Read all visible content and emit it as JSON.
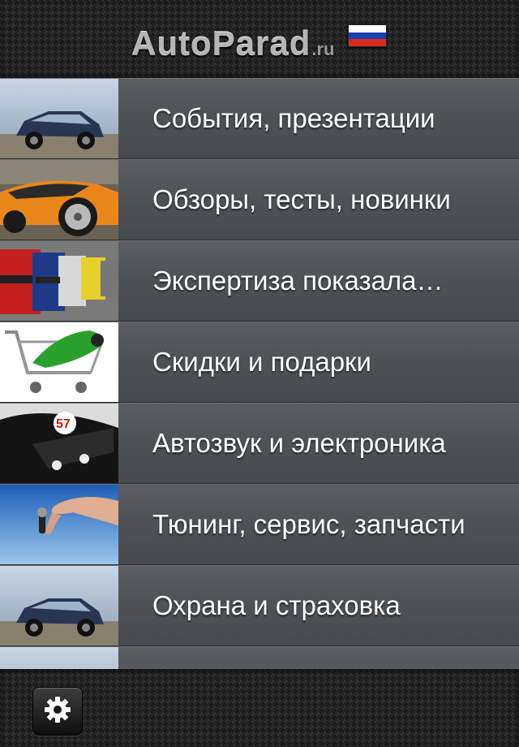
{
  "header": {
    "logo_text": "AutoParad",
    "logo_suffix": ".ru",
    "flag_colors": [
      "#ffffff",
      "#1c3fb0",
      "#d52b1e"
    ]
  },
  "menu": {
    "items": [
      {
        "label": "События, презентации",
        "image": "suv-car-image"
      },
      {
        "label": "Обзоры, тесты, новинки",
        "image": "orange-sports-car-image"
      },
      {
        "label": "Экспертиза показала…",
        "image": "row-of-cars-image"
      },
      {
        "label": "Скидки и подарки",
        "image": "car-in-shopping-cart-image"
      },
      {
        "label": "Автозвук и электроника",
        "image": "black-race-car-image"
      },
      {
        "label": "Тюнинг, сервис, запчасти",
        "image": "hand-with-car-keys-image"
      },
      {
        "label": "Охрана и страховка",
        "image": "suv-car-image"
      },
      {
        "label": "",
        "image": "suv-car-image"
      }
    ]
  },
  "toolbar": {
    "settings_icon": "gear-icon"
  }
}
